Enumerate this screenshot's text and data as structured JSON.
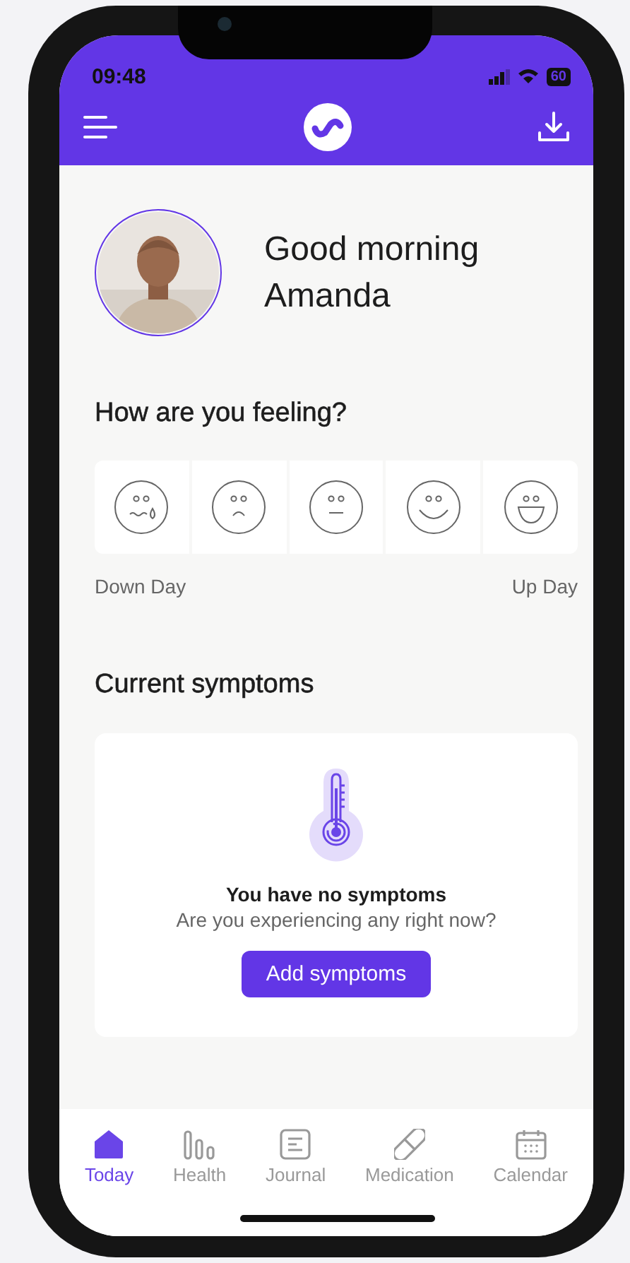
{
  "status_bar": {
    "time": "09:48",
    "battery": "60"
  },
  "greeting": {
    "line_1": "Good morning",
    "line_2": "Amanda"
  },
  "mood": {
    "title": "How are you feeling?",
    "faces": [
      {
        "kind": "crying"
      },
      {
        "kind": "sad"
      },
      {
        "kind": "neutral"
      },
      {
        "kind": "smile"
      },
      {
        "kind": "laugh"
      }
    ],
    "low_label": "Down Day",
    "high_label": "Up Day"
  },
  "symptoms": {
    "title": "Current symptoms",
    "empty_title": "You have no symptoms",
    "empty_text": "Are you experiencing any right now?",
    "button": "Add symptoms"
  },
  "tab_bar": [
    {
      "label": "Today",
      "kind": "home",
      "selected": true
    },
    {
      "label": "Health",
      "kind": "bars",
      "selected": false
    },
    {
      "label": "Journal",
      "kind": "journal",
      "selected": false
    },
    {
      "label": "Medication",
      "kind": "pill",
      "selected": false
    },
    {
      "label": "Calendar",
      "kind": "calendar",
      "selected": false
    }
  ]
}
